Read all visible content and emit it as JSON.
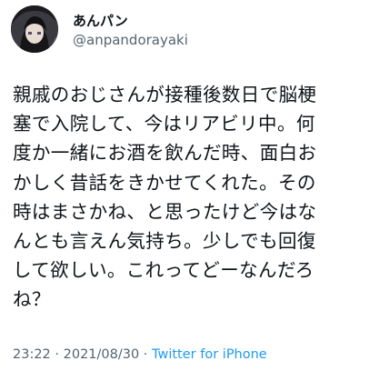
{
  "author": {
    "display_name": "あんパン",
    "handle": "@anpandorayaki"
  },
  "tweet": {
    "lines": [
      "親戚のおじさんが接種後数日で脳梗",
      "塞で入院して、今はリアビリ中。何",
      "度か一緒にお酒を飲んだ時、面白お",
      "かしく昔話をきかせてくれた。その",
      "時はまさかね、と思ったけど今はな",
      "んとも言えん気持ち。少しでも回復",
      "して欲しい。これってどーなんだろ",
      "ね？"
    ]
  },
  "meta": {
    "time": "23:22",
    "separator1": " · ",
    "date": "2021/08/30",
    "separator2": " · ",
    "source": "Twitter for iPhone"
  },
  "colors": {
    "text": "#0f1419",
    "secondary": "#536471",
    "link": "#1d9bf0"
  }
}
